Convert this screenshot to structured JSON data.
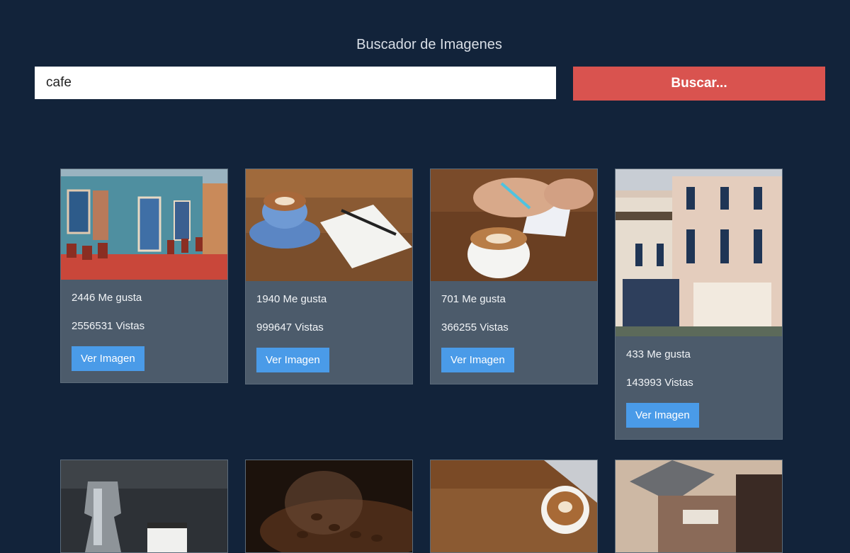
{
  "header": {
    "title": "Buscador de Imagenes"
  },
  "search": {
    "value": "cafe",
    "button_label": "Buscar..."
  },
  "results": [
    {
      "likes": "2446 Me gusta",
      "views": "2556531 Vistas",
      "button_label": "Ver Imagen",
      "image": "street-cafe-painting"
    },
    {
      "likes": "1940 Me gusta",
      "views": "999647 Vistas",
      "button_label": "Ver Imagen",
      "image": "coffee-cup-notebook"
    },
    {
      "likes": "701 Me gusta",
      "views": "366255 Vistas",
      "button_label": "Ver Imagen",
      "image": "latte-hand-writing"
    },
    {
      "likes": "433 Me gusta",
      "views": "143993 Vistas",
      "button_label": "Ver Imagen",
      "image": "hotel-facade"
    },
    {
      "image": "moka-pot-cup"
    },
    {
      "image": "coffee-beans-glass"
    },
    {
      "image": "latte-laptop-table"
    },
    {
      "image": "blurred-building"
    }
  ],
  "colors": {
    "background": "#12233a",
    "card": "#4c5b6b",
    "search_button": "#d9534f",
    "view_button": "#4a9be8"
  }
}
